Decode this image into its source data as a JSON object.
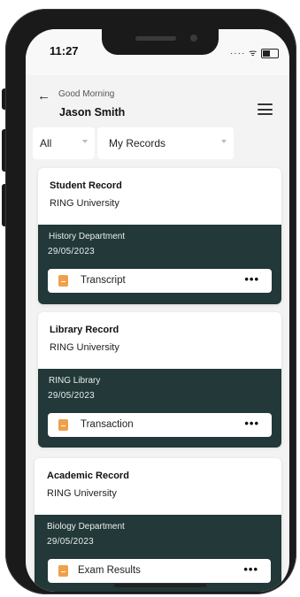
{
  "status": {
    "time": "11:27"
  },
  "header": {
    "greeting": "Good Morning",
    "user_name": "Jason Smith"
  },
  "filters": {
    "category": "All",
    "scope": "My Records"
  },
  "records": [
    {
      "title": "Student Record",
      "institution": "RING University",
      "department": "History Department",
      "date": "29/05/2023",
      "document": "Transcript"
    },
    {
      "title": "Library Record",
      "institution": "RING University",
      "department": "RING Library",
      "date": "29/05/2023",
      "document": "Transaction"
    },
    {
      "title": "Academic Record",
      "institution": "RING University",
      "department": "Biology Department",
      "date": "29/05/2023",
      "document": "Exam Results"
    }
  ],
  "icons": {
    "back": "arrow-left-icon",
    "menu": "hamburger-menu-icon",
    "document": "document-icon",
    "more": "more-horizontal-icon"
  },
  "colors": {
    "card_dark": "#233838",
    "document_icon": "#f0a04a",
    "screen_bg": "#f3f3f3"
  }
}
